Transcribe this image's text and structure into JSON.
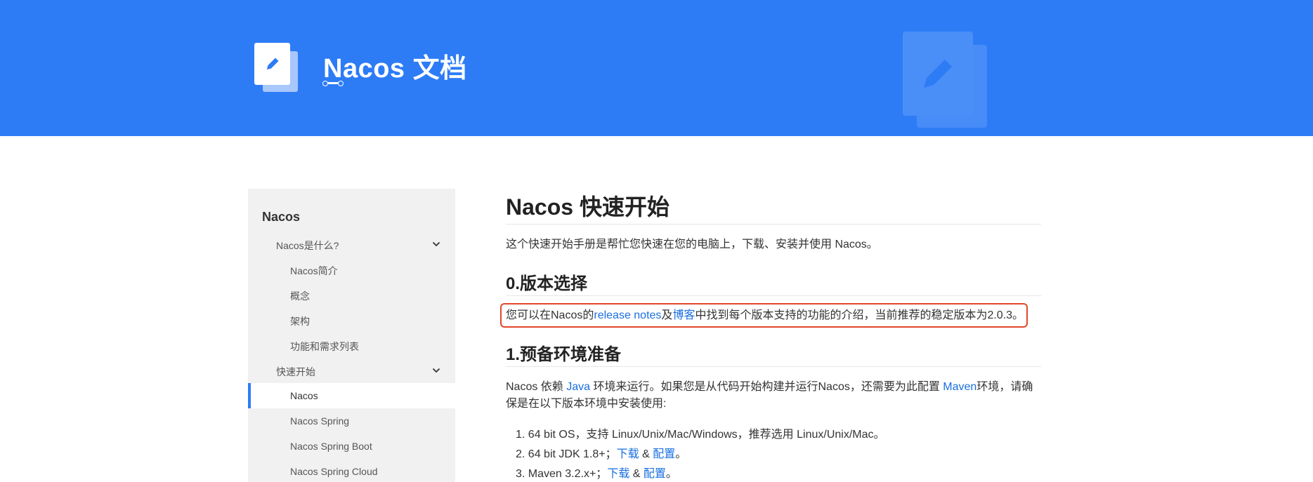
{
  "header": {
    "site_title": "Nacos 文档",
    "background_color": "#2d7cf6",
    "logo_icon": "pencil-document-icon"
  },
  "sidebar": {
    "root": "Nacos",
    "items": [
      {
        "label": "Nacos是什么?",
        "level": 1,
        "expanded": true
      },
      {
        "label": "Nacos简介",
        "level": 2
      },
      {
        "label": "概念",
        "level": 2
      },
      {
        "label": "架构",
        "level": 2
      },
      {
        "label": "功能和需求列表",
        "level": 2
      },
      {
        "label": "快速开始",
        "level": 1,
        "expanded": true
      },
      {
        "label": "Nacos",
        "level": 2,
        "active": true
      },
      {
        "label": "Nacos Spring",
        "level": 2
      },
      {
        "label": "Nacos Spring Boot",
        "level": 2
      },
      {
        "label": "Nacos Spring Cloud",
        "level": 2
      }
    ]
  },
  "content": {
    "title": "Nacos 快速开始",
    "intro": "这个快速开始手册是帮忙您快速在您的电脑上，下载、安装并使用 Nacos。",
    "section0": {
      "heading": "0.版本选择",
      "text_before": "您可以在Nacos的",
      "link1": "release notes",
      "text_mid": "及",
      "link2": "博客",
      "text_after": "中找到每个版本支持的功能的介绍，当前推荐的稳定版本为2.0.3。"
    },
    "section1": {
      "heading": "1.预备环境准备",
      "p1_a": "Nacos 依赖 ",
      "p1_link1": "Java",
      "p1_b": " 环境来运行。如果您是从代码开始构建并运行Nacos，还需要为此配置 ",
      "p1_link2": "Maven",
      "p1_c": "环境，请确",
      "p2": "保是在以下版本环境中安装使用:",
      "list": [
        {
          "num": "1.",
          "text": "64 bit OS，支持 Linux/Unix/Mac/Windows，推荐选用 Linux/Unix/Mac。"
        },
        {
          "num": "2.",
          "text": "64 bit JDK 1.8+；",
          "link1": "下载",
          "amp": " & ",
          "link2": "配置",
          "end": "。"
        },
        {
          "num": "3.",
          "text": "Maven 3.2.x+；",
          "link1": "下载",
          "amp": " & ",
          "link2": "配置",
          "end": "。"
        }
      ]
    }
  }
}
